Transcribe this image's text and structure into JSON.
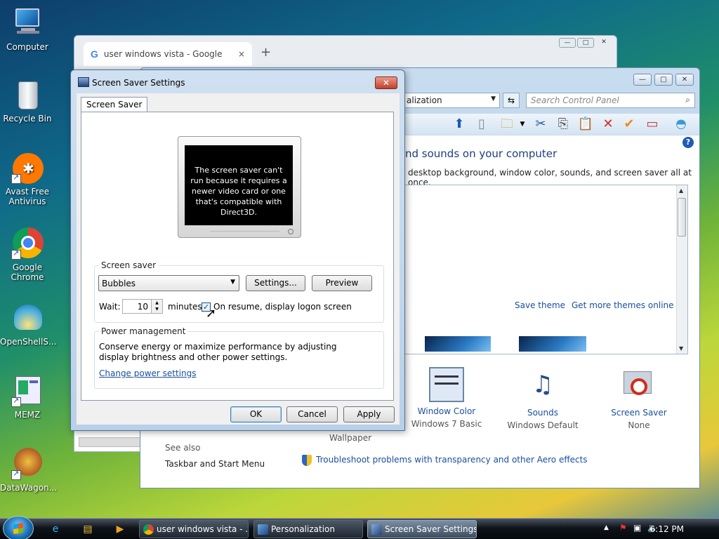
{
  "desktop": {
    "icons": [
      {
        "label": "Computer"
      },
      {
        "label": "Recycle Bin"
      },
      {
        "label": "Avast Free Antivirus"
      },
      {
        "label": "Google Chrome"
      },
      {
        "label": "OpenShellS..."
      },
      {
        "label": "MEMZ"
      },
      {
        "label": "DataWagon..."
      }
    ]
  },
  "chrome": {
    "tab_title": "user windows vista - Google Sea",
    "tab_close": "×",
    "new_tab": "+",
    "ctrl": [
      "—",
      "□",
      "✕"
    ]
  },
  "control_panel": {
    "ctrl": [
      "—",
      "□",
      "✕"
    ],
    "address": "alization",
    "search_placeholder": "Search Control Panel",
    "heading": "nd sounds on your computer",
    "subheading": "desktop background, window color, sounds, and screen saver all at once.",
    "save_theme": "Save theme",
    "get_more_themes": "Get more themes online",
    "items": [
      {
        "title": "",
        "subtitle": "Wallpaper"
      },
      {
        "title": "Window Color",
        "subtitle": "Windows 7 Basic"
      },
      {
        "title": "Sounds",
        "subtitle": "Windows Default"
      },
      {
        "title": "Screen Saver",
        "subtitle": "None"
      }
    ],
    "see_also": "See also",
    "taskbar_link": "Taskbar and Start Menu",
    "troubleshoot": "Troubleshoot problems with transparency and other Aero effects"
  },
  "dialog": {
    "title": "Screen Saver Settings",
    "close": "✕",
    "tab": "Screen Saver",
    "preview_message": "The screen saver can't run because it requires a newer video card or one that's compatible with Direct3D.",
    "screen_saver_group": "Screen saver",
    "screen_saver_selected": "Bubbles",
    "settings_button": "Settings...",
    "preview_button": "Preview",
    "wait_label": "Wait:",
    "wait_value": "10",
    "minutes_label": "minutes",
    "resume_checked": true,
    "resume_label": "On resume, display logon screen",
    "power_group": "Power management",
    "power_text": "Conserve energy or maximize performance by adjusting display brightness and other power settings.",
    "power_link": "Change power settings",
    "ok": "OK",
    "cancel": "Cancel",
    "apply": "Apply"
  },
  "taskbar": {
    "buttons": [
      {
        "label": "user windows vista - ...",
        "active": false
      },
      {
        "label": "Personalization",
        "active": false
      },
      {
        "label": "Screen Saver Settings",
        "active": true
      }
    ],
    "clock": "6:12 PM"
  },
  "colors": {
    "link": "#1a4fa0",
    "dialog_frame": "#b9d0e8",
    "taskbar": "#0f141a"
  }
}
